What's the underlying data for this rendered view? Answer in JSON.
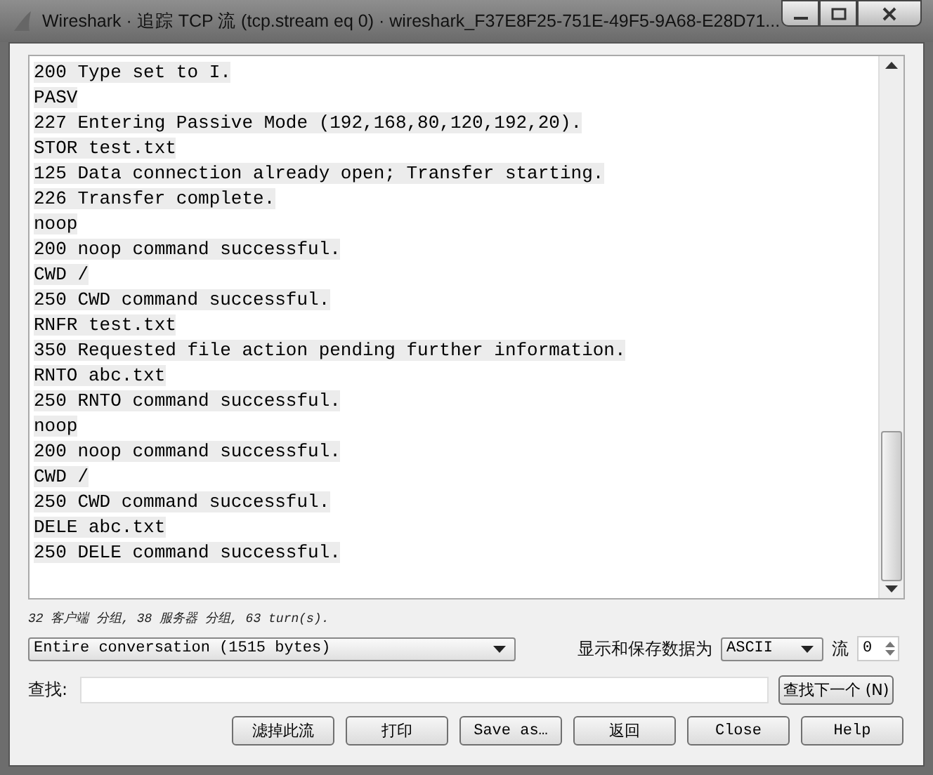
{
  "window": {
    "title": "Wireshark · 追踪 TCP 流 (tcp.stream eq 0) · wireshark_F37E8F25-751E-49F5-9A68-E28D71..."
  },
  "stream_lines": [
    "200 Type set to I.",
    "PASV",
    "227 Entering Passive Mode (192,168,80,120,192,20).",
    "STOR test.txt",
    "125 Data connection already open; Transfer starting.",
    "226 Transfer complete.",
    "noop",
    "200 noop command successful.",
    "CWD /",
    "250 CWD command successful.",
    "RNFR test.txt",
    "350 Requested file action pending further information.",
    "RNTO abc.txt",
    "250 RNTO command successful.",
    "noop",
    "200 noop command successful.",
    "CWD /",
    "250 CWD command successful.",
    "DELE abc.txt",
    "250 DELE command successful."
  ],
  "status": "32 客户端 分组, 38 服务器 分组, 63 turn(s).",
  "conversation_select": {
    "value": "Entire conversation (1515 bytes)"
  },
  "format_label": "显示和保存数据为",
  "format_select": {
    "value": "ASCII"
  },
  "stream_label": "流",
  "stream_spin": {
    "value": "0"
  },
  "find_label": "查找:",
  "find_next_button": "查找下一个 (N)",
  "buttons": [
    "滤掉此流",
    "打印",
    "Save as…",
    "返回",
    "Close",
    "Help"
  ]
}
